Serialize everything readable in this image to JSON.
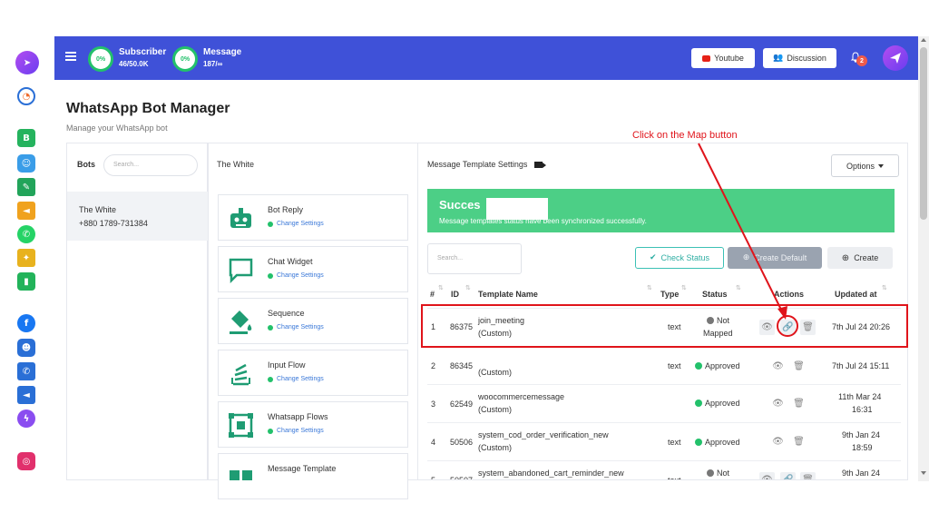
{
  "topbar": {
    "subscriber": {
      "label": "Subscriber",
      "value": "46/50.0K",
      "percent": "0%"
    },
    "message": {
      "label": "Message",
      "value": "187/∞",
      "percent": "0%"
    },
    "youtube_label": "Youtube",
    "discussion_label": "Discussion",
    "notification_count": "2"
  },
  "page": {
    "title": "WhatsApp Bot Manager",
    "subtitle": "Manage your WhatsApp bot"
  },
  "bots_panel": {
    "heading": "Bots",
    "search_placeholder": "Search...",
    "selected_bot": {
      "name": "The White",
      "phone": "+880 1789-731384"
    }
  },
  "bot_settings": {
    "heading": "The White",
    "change_label": "Change Settings",
    "cards": [
      {
        "title": "Bot Reply",
        "icon": "robot-icon"
      },
      {
        "title": "Chat Widget",
        "icon": "chat-bubble-icon"
      },
      {
        "title": "Sequence",
        "icon": "paint-bucket-icon"
      },
      {
        "title": "Input Flow",
        "icon": "stack-icon"
      },
      {
        "title": "Whatsapp Flows",
        "icon": "flow-grid-icon"
      },
      {
        "title": "Message Template",
        "icon": "template-icon"
      }
    ]
  },
  "templates": {
    "heading": "Message Template Settings",
    "options_label": "Options",
    "alert": {
      "title": "Succes",
      "message": "Message templates status have been synchronized successfully."
    },
    "search_placeholder": "Search...",
    "check_status_label": "Check Status",
    "create_default_label": "Create Default",
    "create_label": "Create",
    "columns": [
      "#",
      "ID",
      "Template Name",
      "Type",
      "Status",
      "Actions",
      "Updated at"
    ],
    "rows": [
      {
        "num": "1",
        "id": "86375",
        "name": "join_meeting",
        "sub": "(Custom)",
        "type": "text",
        "status1": "Not",
        "status2": "Mapped",
        "status_kind": "not-mapped",
        "updated1": "7th Jul 24 20:26",
        "updated2": ""
      },
      {
        "num": "2",
        "id": "86345",
        "name": "",
        "sub": "(Custom)",
        "type": "text",
        "status1": "Approved",
        "status2": "",
        "status_kind": "approved",
        "updated1": "7th Jul 24 15:11",
        "updated2": ""
      },
      {
        "num": "3",
        "id": "62549",
        "name": "woocommercemessage",
        "sub": "(Custom)",
        "type": "",
        "status1": "Approved",
        "status2": "",
        "status_kind": "approved",
        "updated1": "11th Mar 24",
        "updated2": "16:31"
      },
      {
        "num": "4",
        "id": "50506",
        "name": "system_cod_order_verification_new",
        "sub": "(Custom)",
        "type": "text",
        "status1": "Approved",
        "status2": "",
        "status_kind": "approved",
        "updated1": "9th Jan 24",
        "updated2": "18:59"
      },
      {
        "num": "5",
        "id": "50507",
        "name": "system_abandoned_cart_reminder_new",
        "sub": "",
        "type": "text",
        "status1": "Not",
        "status2": "",
        "status_kind": "not-mapped",
        "updated1": "9th Jan 24",
        "updated2": ""
      }
    ]
  },
  "annotation": {
    "callout": "Click on the Map button"
  },
  "colors": {
    "brand": "#3f51d8",
    "success": "#4ccf86",
    "approved": "#23c16b",
    "highlight": "#e0141b"
  }
}
